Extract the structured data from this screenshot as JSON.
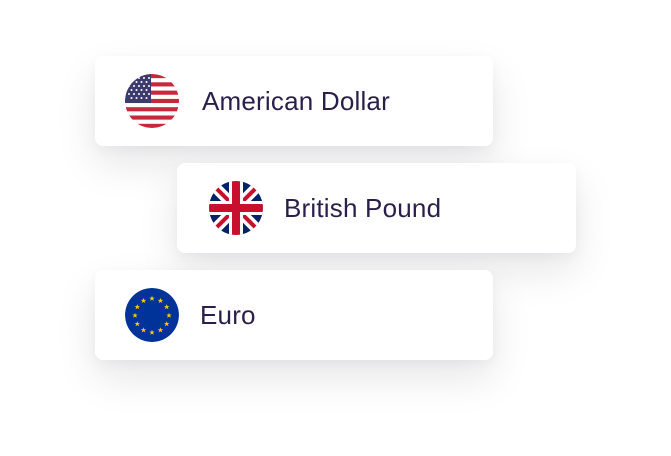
{
  "currencies": [
    {
      "label": "American Dollar",
      "flag_icon": "us-flag-icon"
    },
    {
      "label": "British Pound",
      "flag_icon": "uk-flag-icon"
    },
    {
      "label": "Euro",
      "flag_icon": "eu-flag-icon"
    }
  ],
  "colors": {
    "text": "#2a1f4a",
    "card_bg": "#ffffff",
    "us_red": "#c8283c",
    "us_blue": "#3c3b6e",
    "uk_blue": "#012169",
    "uk_red": "#c8102e",
    "eu_blue": "#003399",
    "eu_gold": "#ffcc00"
  }
}
